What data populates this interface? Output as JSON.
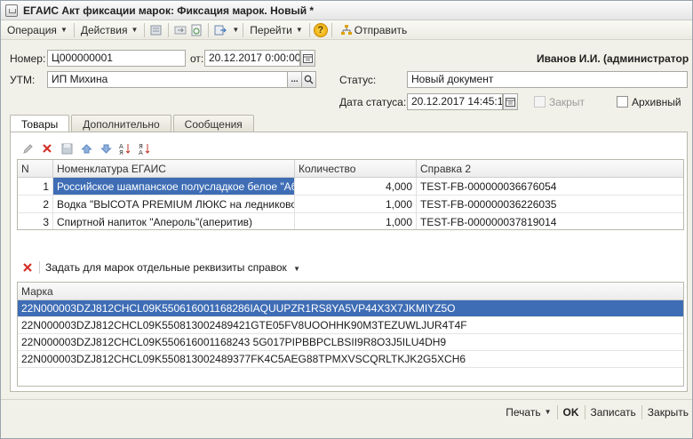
{
  "window": {
    "title": "ЕГАИС Акт фиксации марок: Фиксация марок. Новый *"
  },
  "toolbar": {
    "operation": "Операция",
    "actions": "Действия",
    "go": "Перейти",
    "help": "?",
    "send": "Отправить"
  },
  "header": {
    "number_label": "Номер:",
    "number_value": "Ц000000001",
    "date_label": "от:",
    "date_value": "20.12.2017  0:00:00",
    "user": "Иванов И.И. (администратор",
    "utm_label": "УТМ:",
    "utm_value": "ИП Михина",
    "utm_dots": "...",
    "status_label": "Статус:",
    "status_value": "Новый документ",
    "status_date_label": "Дата статуса:",
    "status_date_value": "20.12.2017 14:45:17",
    "closed_label": "Закрыт",
    "archive_label": "Архивный"
  },
  "tabs": [
    {
      "label": "Товары"
    },
    {
      "label": "Дополнительно"
    },
    {
      "label": "Сообщения"
    }
  ],
  "goods": {
    "columns": [
      "N",
      "Номенклатура ЕГАИС",
      "Количество",
      "Справка 2"
    ],
    "rows": [
      {
        "n": "1",
        "name": "Российское шампанское полусладкое белое \"Аб...",
        "qty": "4,000",
        "ref": "TEST-FB-000000036676054"
      },
      {
        "n": "2",
        "name": "Водка \"ВЫСОТА PREMIUM ЛЮКС на ледниковой ...",
        "qty": "1,000",
        "ref": "TEST-FB-000000036226035"
      },
      {
        "n": "3",
        "name": "Спиртной напиток \"Апероль\"(аперитив)",
        "qty": "1,000",
        "ref": "TEST-FB-000000037819014"
      }
    ]
  },
  "marks": {
    "action_label": "Задать для марок отдельные реквизиты справок",
    "column": "Марка",
    "rows": [
      "22N000003DZJ812CHCL09K550616001168286IAQUUPZR1RS8YA5VP44X3X7JKMIYZ5O",
      "22N000003DZJ812CHCL09K550813002489421GTE05FV8UOOHHK90M3TEZUWLJUR4T4F",
      "22N000003DZJ812CHCL09K550616001168243 5G017PIPBBPCLBSII9R8O3J5ILU4DH9",
      "22N000003DZJ812CHCL09K550813002489377FK4C5AEG88TPMXVSCQRLTKJK2G5XCH6"
    ]
  },
  "footer": {
    "print": "Печать",
    "ok": "OK",
    "save": "Записать",
    "close": "Закрыть"
  }
}
